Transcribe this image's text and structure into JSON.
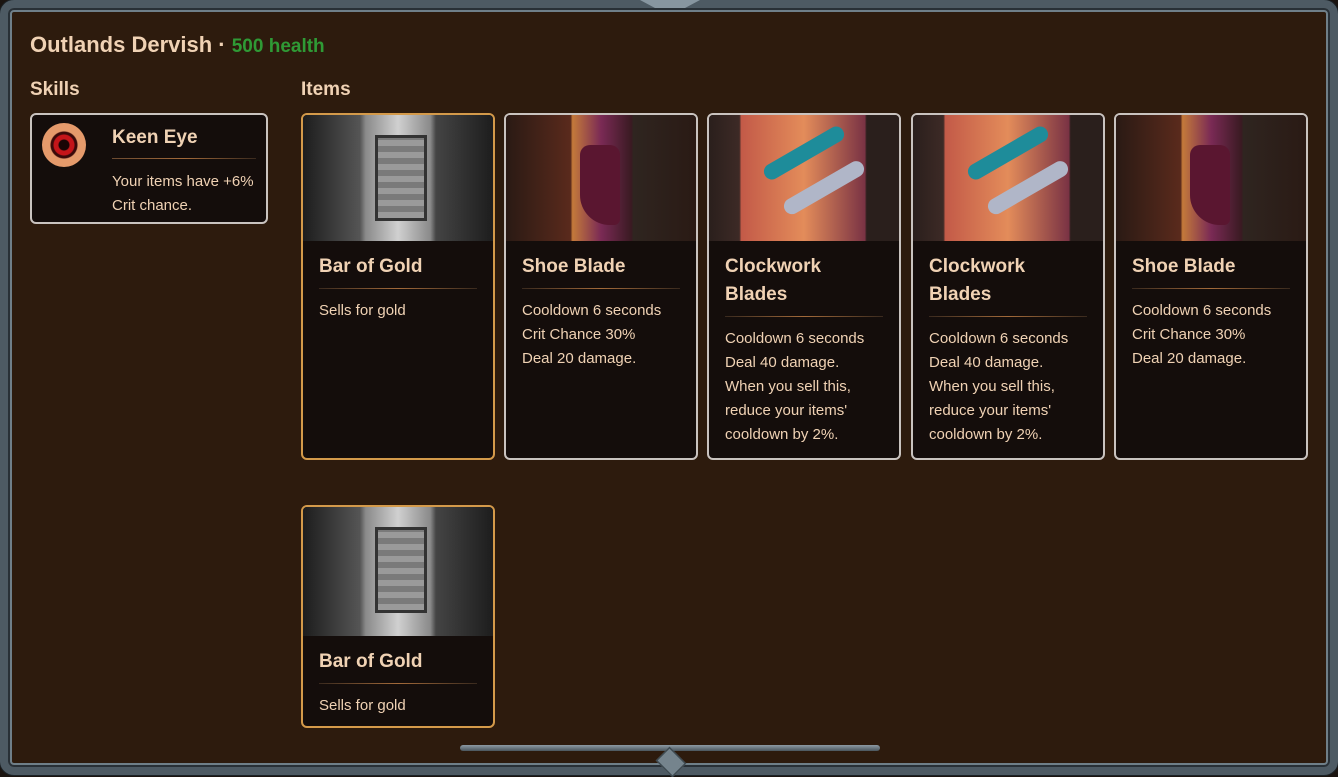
{
  "header": {
    "title": "Outlands Dervish",
    "separator": "·",
    "health": "500 health"
  },
  "skills": {
    "label": "Skills",
    "items": [
      {
        "name": "Keen Eye",
        "description": "Your items have +6% Crit chance.",
        "icon": "eye-icon"
      }
    ]
  },
  "items": {
    "label": "Items",
    "cards": [
      {
        "name": "Bar of Gold",
        "lines": [
          "Sells for gold"
        ],
        "art": "gold-bar-art",
        "highlight": "#d49a4a"
      },
      {
        "name": "Shoe Blade",
        "lines": [
          "Cooldown 6 seconds",
          "Crit Chance 30%",
          "Deal 20 damage."
        ],
        "art": "shoe-blade-art"
      },
      {
        "name": "Clockwork Blades",
        "lines": [
          "Cooldown 6 seconds",
          "Deal 40 damage.",
          "When you sell this, reduce your items' cooldown by 2%."
        ],
        "art": "clockwork-blades-art"
      },
      {
        "name": "Clockwork Blades",
        "lines": [
          "Cooldown 6 seconds",
          "Deal 40 damage.",
          "When you sell this, reduce your items' cooldown by 2%."
        ],
        "art": "clockwork-blades-art"
      },
      {
        "name": "Shoe Blade",
        "lines": [
          "Cooldown 6 seconds",
          "Crit Chance 30%",
          "Deal 20 damage."
        ],
        "art": "shoe-blade-art"
      },
      {
        "name": "Bar of Gold",
        "lines": [
          "Sells for gold"
        ],
        "art": "gold-bar-art",
        "highlight": "#d49a4a"
      }
    ]
  },
  "colors": {
    "background": "#2d1b0d",
    "text": "#f0d2b4",
    "health": "#2f9a35",
    "card": "#140d0b",
    "gold_border": "#d49a4a",
    "border": "#c9c3bf"
  }
}
